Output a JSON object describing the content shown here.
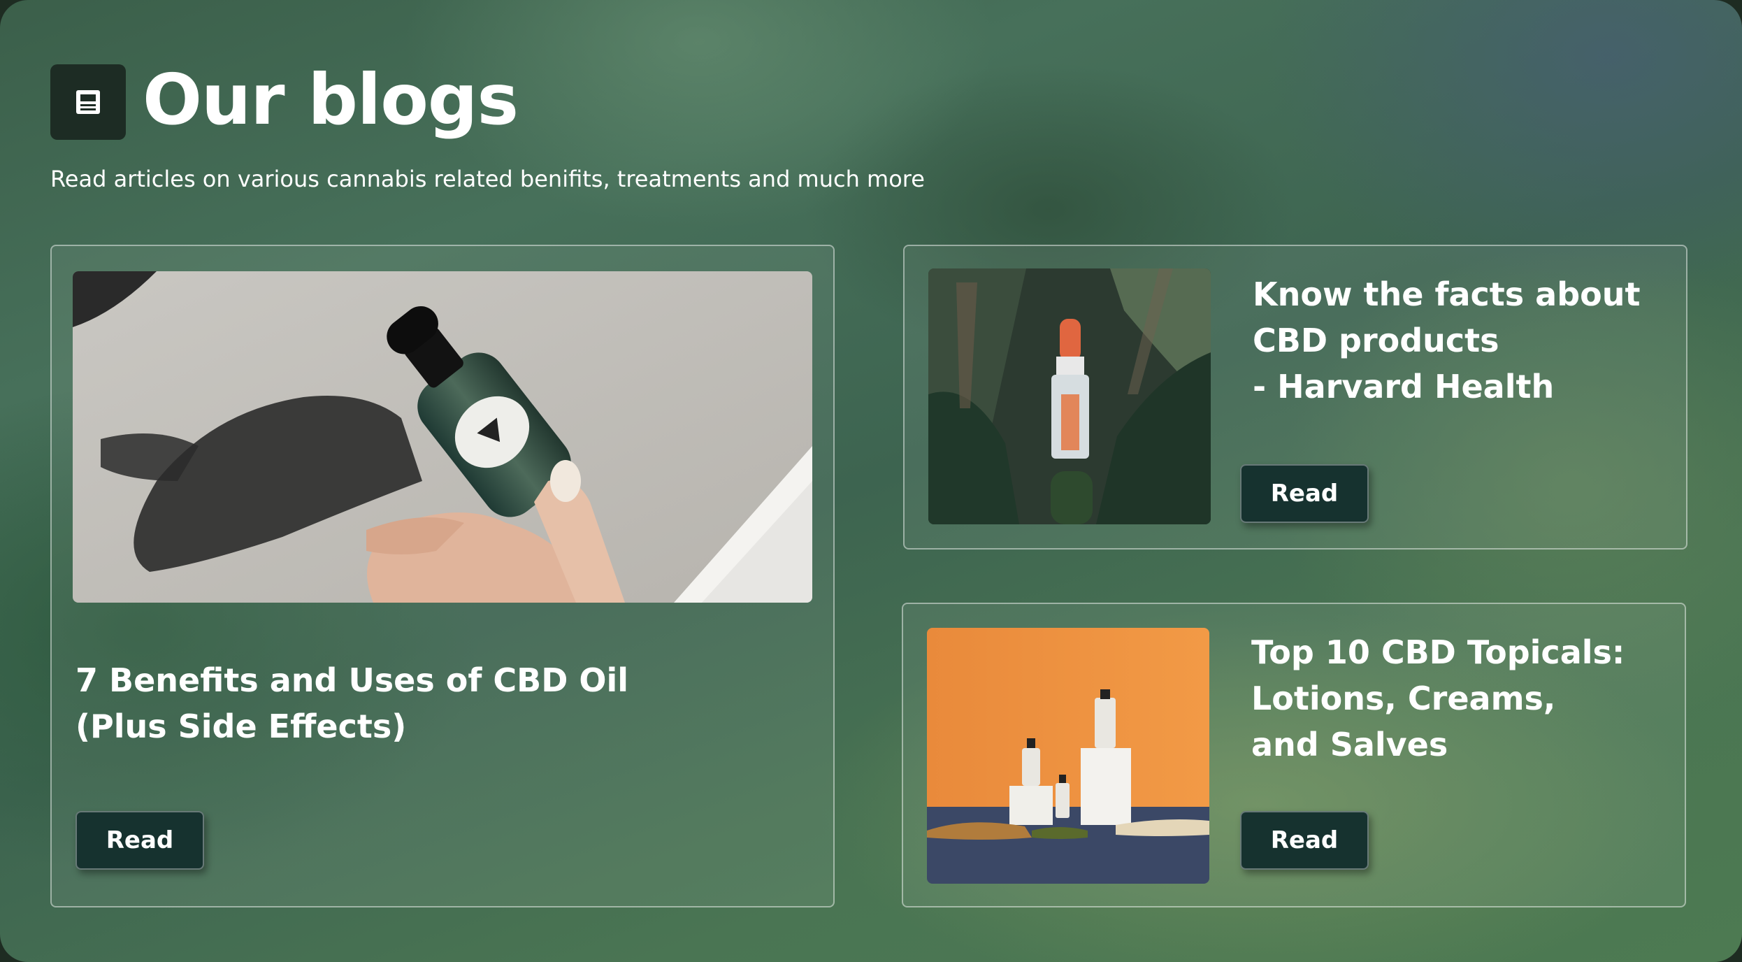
{
  "header": {
    "icon": "document-icon",
    "title": "Our blogs",
    "subtitle": "Read articles on various cannabis related benifits, treatments and much more"
  },
  "posts": [
    {
      "title": "7 Benefits and Uses of CBD Oil\n(Plus Side Effects)",
      "button_label": "Read",
      "image": "hand-holding-cbd-dropper-bottle-photo"
    },
    {
      "title": "Know the facts about\nCBD products\n- Harvard Health",
      "button_label": "Read",
      "image": "cbd-elixir-bottle-among-cactus-photo"
    },
    {
      "title": "Top 10 CBD Topicals:\nLotions, Creams,\nand Salves",
      "button_label": "Read",
      "image": "three-cbd-bottles-on-orange-background-photo"
    }
  ],
  "colors": {
    "button_bg": "#16322f",
    "icon_bg": "#1d2c24",
    "text": "#ffffff"
  }
}
